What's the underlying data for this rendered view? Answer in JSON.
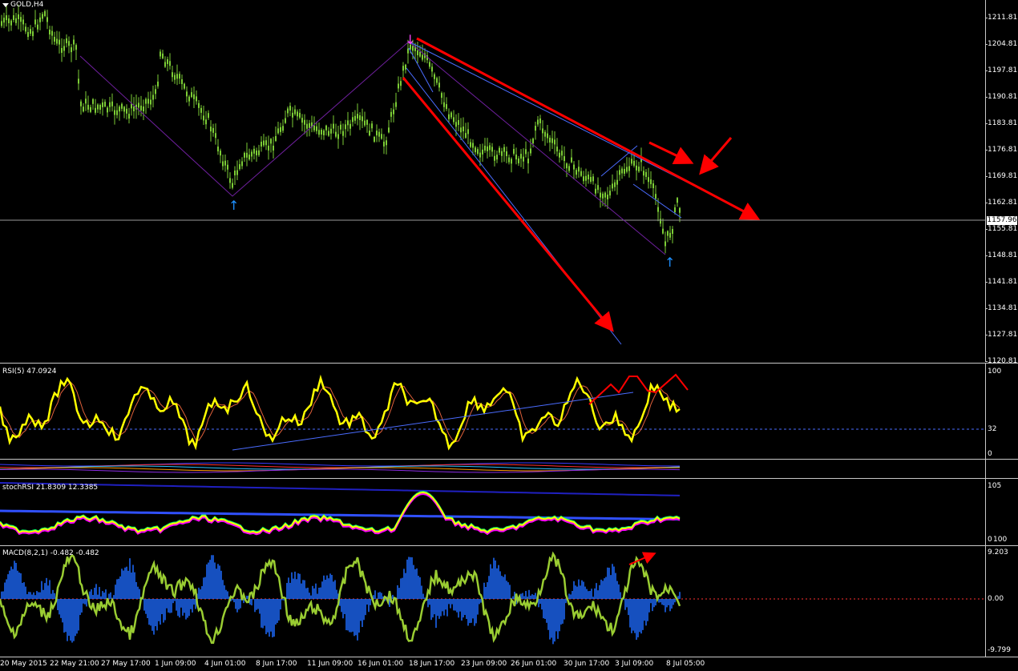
{
  "chart_title": "GOLD,H4",
  "current_price": "1157.96",
  "main_scale": [
    "1211.81",
    "1204.81",
    "1197.81",
    "1190.81",
    "1183.81",
    "1176.81",
    "1169.81",
    "1162.81",
    "1155.81",
    "1148.81",
    "1141.81",
    "1134.81",
    "1127.81",
    "1120.81"
  ],
  "rsi": {
    "label": "RSI(5) 47.0924",
    "levels": [
      "100",
      "32",
      "0"
    ]
  },
  "stochrsi": {
    "label": "stochRSI 21.8309 12.3385",
    "levels": [
      "105",
      "0"
    ],
    "extra_level": "100"
  },
  "macd": {
    "label": "MACD(8,2,1) -0.482 -0.482",
    "levels": [
      "9.203",
      "0.00",
      "-9.799"
    ]
  },
  "time_axis": [
    "20 May 2015",
    "22 May 21:00",
    "27 May 17:00",
    "1 Jun 09:00",
    "4 Jun 01:00",
    "8 Jun 17:00",
    "11 Jun 09:00",
    "16 Jun 01:00",
    "18 Jun 17:00",
    "23 Jun 09:00",
    "26 Jun 01:00",
    "30 Jun 17:00",
    "3 Jul 09:00",
    "8 Jul 05:00"
  ],
  "colors": {
    "candle": "#7ccd36",
    "rsi_line": "#ffff00",
    "rsi_signal": "#e0603a",
    "annotation": "#ff0000",
    "trend_blue": "#4a6cff",
    "macd_hist": "#1e6bff",
    "macd_line": "#9acd32",
    "stoch_k": "#ffff00",
    "stoch_d": "#ff00ff",
    "stoch_green": "#00ff66",
    "stoch_band": "#2020c0"
  },
  "icons": {
    "menu": "triangle-down-icon",
    "buy": "up-arrow-icon",
    "sell": "down-arrow-icon"
  }
}
